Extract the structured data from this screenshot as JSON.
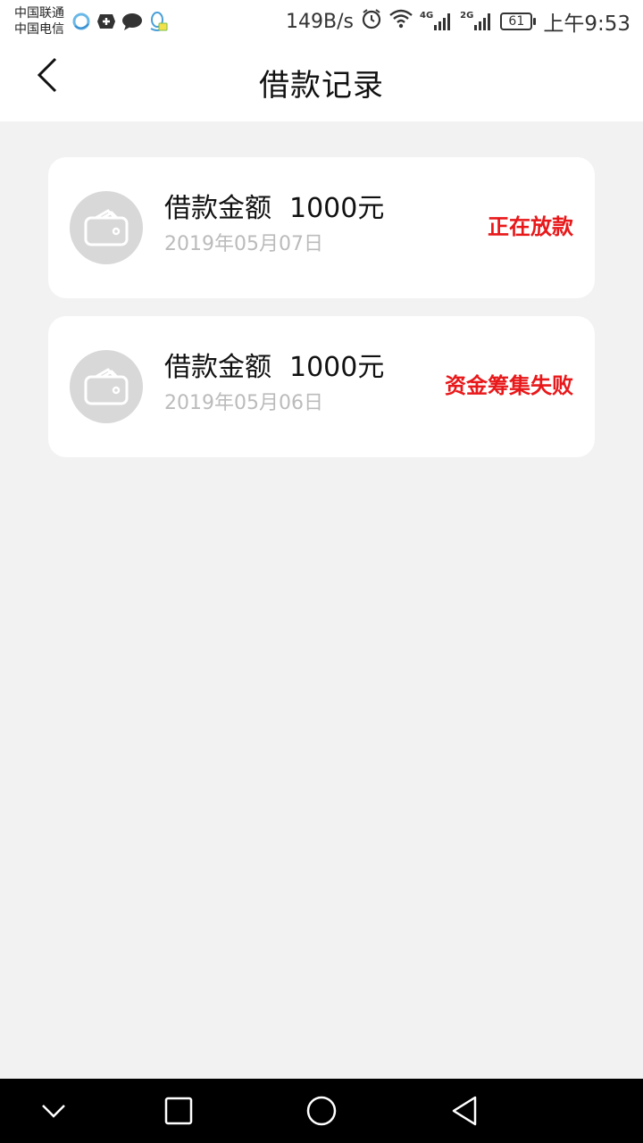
{
  "status_bar": {
    "carrier_1": "中国联通",
    "carrier_2": "中国电信",
    "net_speed": "149B/s",
    "battery": "61",
    "time": "上午9:53",
    "signal_1_label": "4G",
    "signal_2_label": "2G"
  },
  "header": {
    "title": "借款记录"
  },
  "records": [
    {
      "amount_label": "借款金额",
      "amount": "1000元",
      "date": "2019年05月07日",
      "status": "正在放款"
    },
    {
      "amount_label": "借款金额",
      "amount": "1000元",
      "date": "2019年05月06日",
      "status": "资金筹集失败"
    }
  ],
  "colors": {
    "status_text": "#e8181a",
    "date_text": "#bbbbbb",
    "avatar_bg": "#d8d8d8",
    "page_bg": "#f2f2f2"
  },
  "icons": {
    "back": "chevron-left-icon",
    "record": "wallet-icon",
    "nav_down": "chevron-down-icon",
    "nav_recents": "square-icon",
    "nav_home": "circle-icon",
    "nav_back": "triangle-back-icon"
  }
}
